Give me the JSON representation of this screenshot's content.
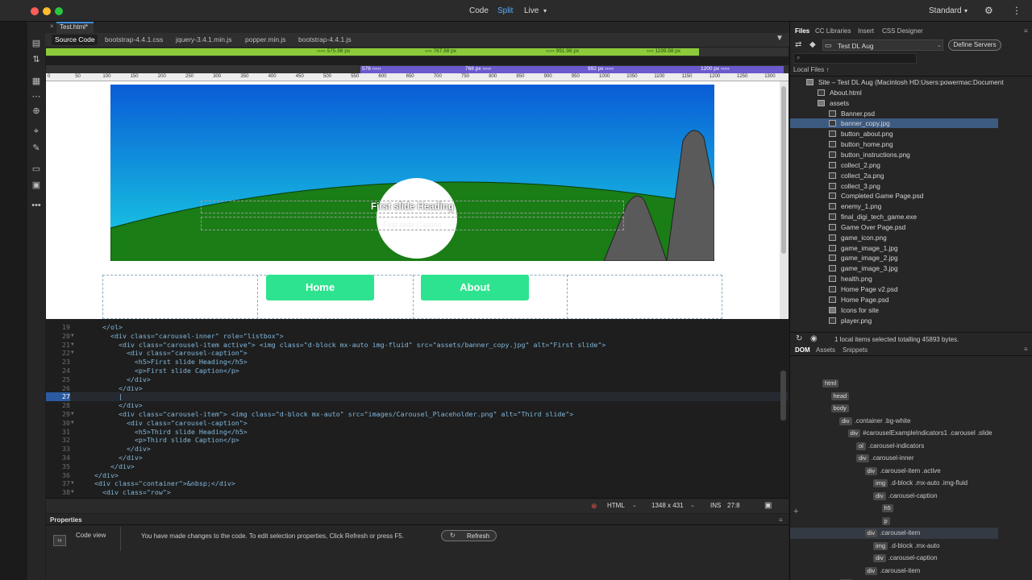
{
  "titlebar": {
    "code": "Code",
    "split": "Split",
    "live": "Live",
    "workspace": "Standard"
  },
  "doc_tab": "Test.html*",
  "related_files": [
    "Source Code",
    "bootstrap-4.4.1.css",
    "jquery-3.4.1.min.js",
    "popper.min.js",
    "bootstrap-4.4.1.js"
  ],
  "media_queries_1": [
    "575.98 px",
    "767.98 px",
    "991.98 px",
    "1199.98 px"
  ],
  "media_queries_2": [
    "576",
    "768 px",
    "992 px",
    "1200 px"
  ],
  "ruler_labels": [
    "0",
    "50",
    "100",
    "150",
    "200",
    "250",
    "300",
    "350",
    "400",
    "450",
    "500",
    "550",
    "600",
    "650",
    "700",
    "750",
    "800",
    "850",
    "900",
    "950",
    "1000",
    "1050",
    "1100",
    "1150",
    "1200",
    "1250",
    "1300"
  ],
  "live": {
    "caption_heading": "First slide Heading",
    "caption_text": "First slide Caption",
    "btn_home": "Home",
    "btn_about": "About"
  },
  "code_lines": [
    {
      "n": "19",
      "fold": "",
      "text": "      </ol>"
    },
    {
      "n": "20",
      "fold": "▼",
      "text": "        <div class=\"carousel-inner\" role=\"listbox\">"
    },
    {
      "n": "21",
      "fold": "▼",
      "text": "          <div class=\"carousel-item active\"> <img class=\"d-block mx-auto img-fluid\" src=\"assets/banner_copy.jpg\" alt=\"First slide\">"
    },
    {
      "n": "22",
      "fold": "▼",
      "text": "            <div class=\"carousel-caption\">"
    },
    {
      "n": "23",
      "fold": "",
      "text": "              <h5>First slide Heading</h5>"
    },
    {
      "n": "24",
      "fold": "",
      "text": "              <p>First slide Caption</p>"
    },
    {
      "n": "25",
      "fold": "",
      "text": "            </div>"
    },
    {
      "n": "26",
      "fold": "",
      "text": "          </div>"
    },
    {
      "n": "27",
      "fold": "",
      "text": "          |"
    },
    {
      "n": "28",
      "fold": "",
      "text": "          </div>"
    },
    {
      "n": "29",
      "fold": "▼",
      "text": "          <div class=\"carousel-item\"> <img class=\"d-block mx-auto\" src=\"images/Carousel_Placeholder.png\" alt=\"Third slide\">"
    },
    {
      "n": "30",
      "fold": "▼",
      "text": "            <div class=\"carousel-caption\">"
    },
    {
      "n": "31",
      "fold": "",
      "text": "              <h5>Third slide Heading</h5>"
    },
    {
      "n": "32",
      "fold": "",
      "text": "              <p>Third slide Caption</p>"
    },
    {
      "n": "33",
      "fold": "",
      "text": "            </div>"
    },
    {
      "n": "34",
      "fold": "",
      "text": "          </div>"
    },
    {
      "n": "35",
      "fold": "",
      "text": "        </div>"
    },
    {
      "n": "36",
      "fold": "",
      "text": "    </div>"
    },
    {
      "n": "37",
      "fold": "▼",
      "text": "    <div class=\"container\">&nbsp;</div>"
    },
    {
      "n": "38",
      "fold": "▼",
      "text": "      <div class=\"row\">"
    }
  ],
  "status": {
    "language": "HTML",
    "size": "1348 x 431",
    "mode": "INS",
    "cursor": "27:8"
  },
  "properties": {
    "title": "Properties",
    "code_view": "Code view",
    "message": "You have made changes to the code. To edit selection properties, Click Refresh or press F5.",
    "refresh": "Refresh"
  },
  "panel_tabs": [
    "Files",
    "CC Libraries",
    "Insert",
    "CSS Designer"
  ],
  "files": {
    "site": "Test DL Aug",
    "define_servers": "Define Servers",
    "local_files": "Local Files ↑",
    "items": [
      {
        "name": "Site – Test DL Aug (Macintosh HD:Users:powermac:Document",
        "indent": 0
      },
      {
        "name": "About.html",
        "indent": 1
      },
      {
        "name": "assets",
        "indent": 1
      },
      {
        "name": "Banner.psd",
        "indent": 2
      },
      {
        "name": "banner_copy.jpg",
        "indent": 2
      },
      {
        "name": "button_about.png",
        "indent": 2
      },
      {
        "name": "button_home.png",
        "indent": 2
      },
      {
        "name": "button_instructions.png",
        "indent": 2
      },
      {
        "name": "collect_2.png",
        "indent": 2
      },
      {
        "name": "collect_2a.png",
        "indent": 2
      },
      {
        "name": "collect_3.png",
        "indent": 2
      },
      {
        "name": "Completed Game Page.psd",
        "indent": 2
      },
      {
        "name": "enemy_1.png",
        "indent": 2
      },
      {
        "name": "final_digi_tech_game.exe",
        "indent": 2
      },
      {
        "name": "Game Over Page.psd",
        "indent": 2
      },
      {
        "name": "game_icon.png",
        "indent": 2
      },
      {
        "name": "game_image_1.jpg",
        "indent": 2
      },
      {
        "name": "game_image_2.jpg",
        "indent": 2
      },
      {
        "name": "game_image_3.jpg",
        "indent": 2
      },
      {
        "name": "health.png",
        "indent": 2
      },
      {
        "name": "Home Page v2.psd",
        "indent": 2
      },
      {
        "name": "Home Page.psd",
        "indent": 2
      },
      {
        "name": "Icons for site",
        "indent": 2
      },
      {
        "name": "player.png",
        "indent": 2
      }
    ],
    "status": "1 local items selected totalling 45893 bytes."
  },
  "dom_tabs": [
    "DOM",
    "Assets",
    "Snippets"
  ],
  "dom": [
    {
      "tag": "html",
      "label": "",
      "indent": 0
    },
    {
      "tag": "head",
      "label": "",
      "indent": 1
    },
    {
      "tag": "body",
      "label": "",
      "indent": 1
    },
    {
      "tag": "div",
      "label": ".container .bg-white",
      "indent": 2
    },
    {
      "tag": "div",
      "label": "#carouselExampleIndicators1 .carousel .slide",
      "indent": 3
    },
    {
      "tag": "ol",
      "label": ".carousel-indicators",
      "indent": 4
    },
    {
      "tag": "div",
      "label": ".carousel-inner",
      "indent": 4
    },
    {
      "tag": "div",
      "label": ".carousel-item .active",
      "indent": 5
    },
    {
      "tag": "img",
      "label": ".d-block .mx-auto .img-fluid",
      "indent": 6
    },
    {
      "tag": "div",
      "label": ".carousel-caption",
      "indent": 6
    },
    {
      "tag": "h5",
      "label": "",
      "indent": 7
    },
    {
      "tag": "p",
      "label": "",
      "indent": 7
    },
    {
      "tag": "div",
      "label": ".carousel-item",
      "indent": 5
    },
    {
      "tag": "img",
      "label": ".d-block .mx-auto",
      "indent": 6
    },
    {
      "tag": "div",
      "label": ".carousel-caption",
      "indent": 6
    },
    {
      "tag": "div",
      "label": ".carousel-item",
      "indent": 5
    },
    {
      "tag": "div",
      "label": ".container",
      "indent": 2
    }
  ],
  "colors": {
    "accent_green": "#8ccc3a",
    "mq_purple": "#6a5acd",
    "button_green": "#2ee38f",
    "selection": "#3d5a80"
  }
}
